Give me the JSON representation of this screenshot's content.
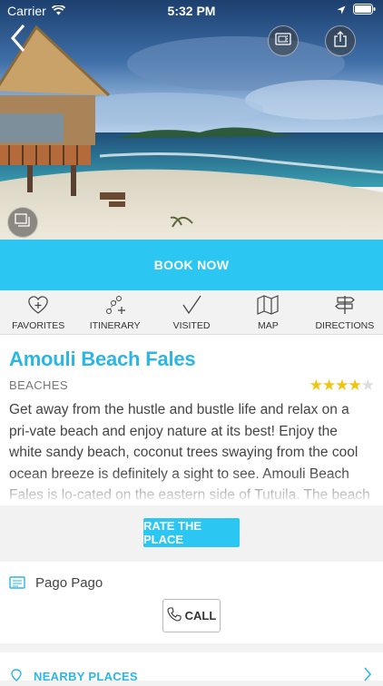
{
  "status_bar": {
    "carrier": "Carrier",
    "time": "5:32 PM"
  },
  "hero": {
    "alt_icons": [
      "back-chevron-icon",
      "ticket-icon",
      "share-icon",
      "gallery-icon"
    ]
  },
  "book_now": "BOOK NOW",
  "actions": [
    {
      "label": "FAVORITES",
      "icon": "heart-plus-icon"
    },
    {
      "label": "ITINERARY",
      "icon": "route-plus-icon"
    },
    {
      "label": "VISITED",
      "icon": "checkmark-icon"
    },
    {
      "label": "MAP",
      "icon": "map-icon"
    },
    {
      "label": "DIRECTIONS",
      "icon": "signpost-icon"
    }
  ],
  "place": {
    "title": "Amouli Beach Fales",
    "category": "BEACHES",
    "rating": 4,
    "rating_max": 5,
    "description": "Get away from the hustle and bustle life and relax on a pri-vate beach and enjoy nature at its best! Enjoy the white sandy beach, coconut trees swaying from the cool ocean breeze is definitely a sight to see. Amouli Beach Fales is lo-cated on the eastern side of Tutuila. The beach fales is a"
  },
  "rate_button": "RATE THE PLACE",
  "location": "Pago Pago",
  "call_button": "CALL",
  "nearby": "NEARBY PLACES",
  "colors": {
    "accent": "#2bc6f2",
    "title": "#2bb6e6",
    "star": "#f1c40f"
  }
}
